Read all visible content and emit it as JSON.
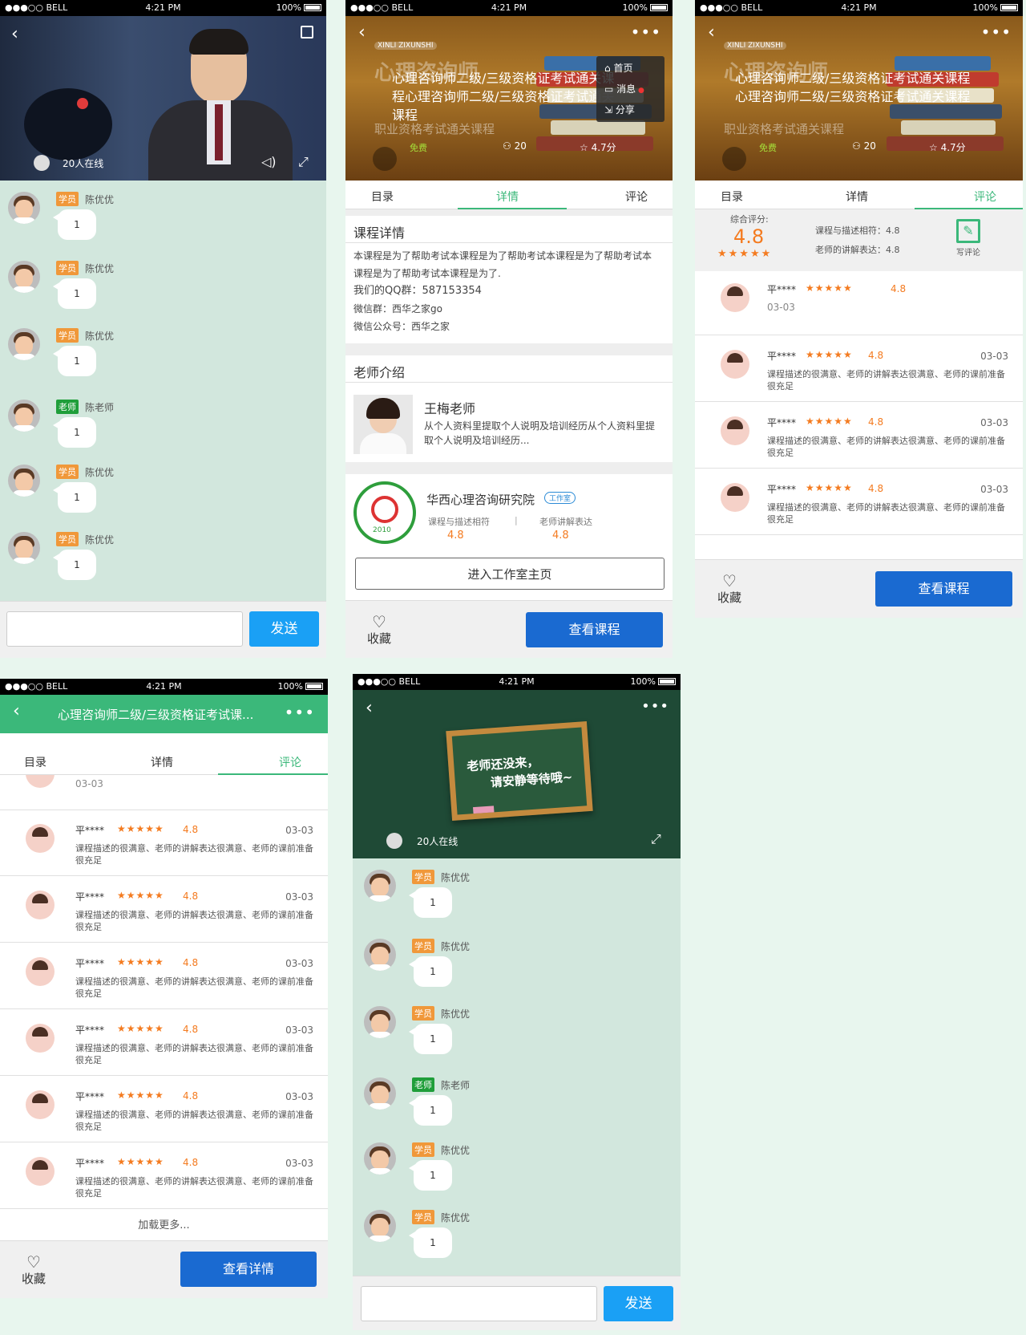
{
  "status": {
    "carrier": "●●●○○ BELL",
    "wifi": "ᯤ",
    "time": "4:21 PM",
    "bt": "✱",
    "battery": "100%"
  },
  "live": {
    "online": "20人在线"
  },
  "chat": [
    {
      "tag": "学员",
      "role": "stu",
      "name": "陈优优",
      "text": "1"
    },
    {
      "tag": "学员",
      "role": "stu",
      "name": "陈优优",
      "text": "1"
    },
    {
      "tag": "学员",
      "role": "stu",
      "name": "陈优优",
      "text": "1"
    },
    {
      "tag": "老师",
      "role": "tea",
      "name": "陈老师",
      "text": "1"
    },
    {
      "tag": "学员",
      "role": "stu",
      "name": "陈优优",
      "text": "1"
    },
    {
      "tag": "学员",
      "role": "stu",
      "name": "陈优优",
      "text": "1"
    }
  ],
  "send_label": "发送",
  "course": {
    "brand": "XINLI ZIXUNSHI",
    "bg_title": "心理咨询师",
    "title": "心理咨询师二级/三级资格证考试通关课程心理咨询师二级/三级资格证考试通关课程",
    "subtitle": "职业资格考试通关课程",
    "price": "免费",
    "students": "20",
    "rating": "4.7分",
    "short_title": "心理咨询师二级/三级资格证考试课..."
  },
  "menu": {
    "home": "首页",
    "msg": "消息",
    "share": "分享"
  },
  "tabs": {
    "catalog": "目录",
    "detail": "详情",
    "comment": "评论"
  },
  "detail": {
    "heading": "课程详情",
    "body": "本课程是为了帮助考试本课程是为了帮助考试本课程是为了帮助考试本课程是为了帮助考试本课程是为了.",
    "qq": "我们的QQ群：587153354",
    "wechat": "微信群：西华之家go",
    "public": "微信公众号：西华之家"
  },
  "teacher": {
    "heading": "老师介绍",
    "name": "王梅老师",
    "intro": "从个人资料里提取个人说明及培训经历从个人资料里提取个人说明及培训经历..."
  },
  "studio": {
    "name": "华西心理咨询研究院",
    "badge": "工作室",
    "l1": "课程与描述相符",
    "v1": "4.8",
    "l2": "老师讲解表达",
    "v2": "4.8",
    "enter": "进入工作室主页",
    "logo_year": "2010"
  },
  "bottom": {
    "fav": "收藏",
    "view_course": "查看课程",
    "view_detail": "查看详情"
  },
  "summary": {
    "label": "综合评分:",
    "score": "4.8",
    "stars": "★★★★★",
    "l1": "课程与描述相符：4.8",
    "l2": "老师的讲解表达：4.8",
    "write": "写评论"
  },
  "review": {
    "name": "平****",
    "stars": "★★★★★",
    "score": "4.8",
    "date": "03-03",
    "text": "课程描述的很满意、老师的讲解表达很满意、老师的课前准备很充足"
  },
  "load_more": "加载更多...",
  "board": {
    "line1": "老师还没来，",
    "line2": "请安静等待哦~"
  },
  "colors": {
    "green": "#3bb87a",
    "blue": "#1a6ad1",
    "send": "#1aa0f5",
    "orange": "#f47b20"
  }
}
